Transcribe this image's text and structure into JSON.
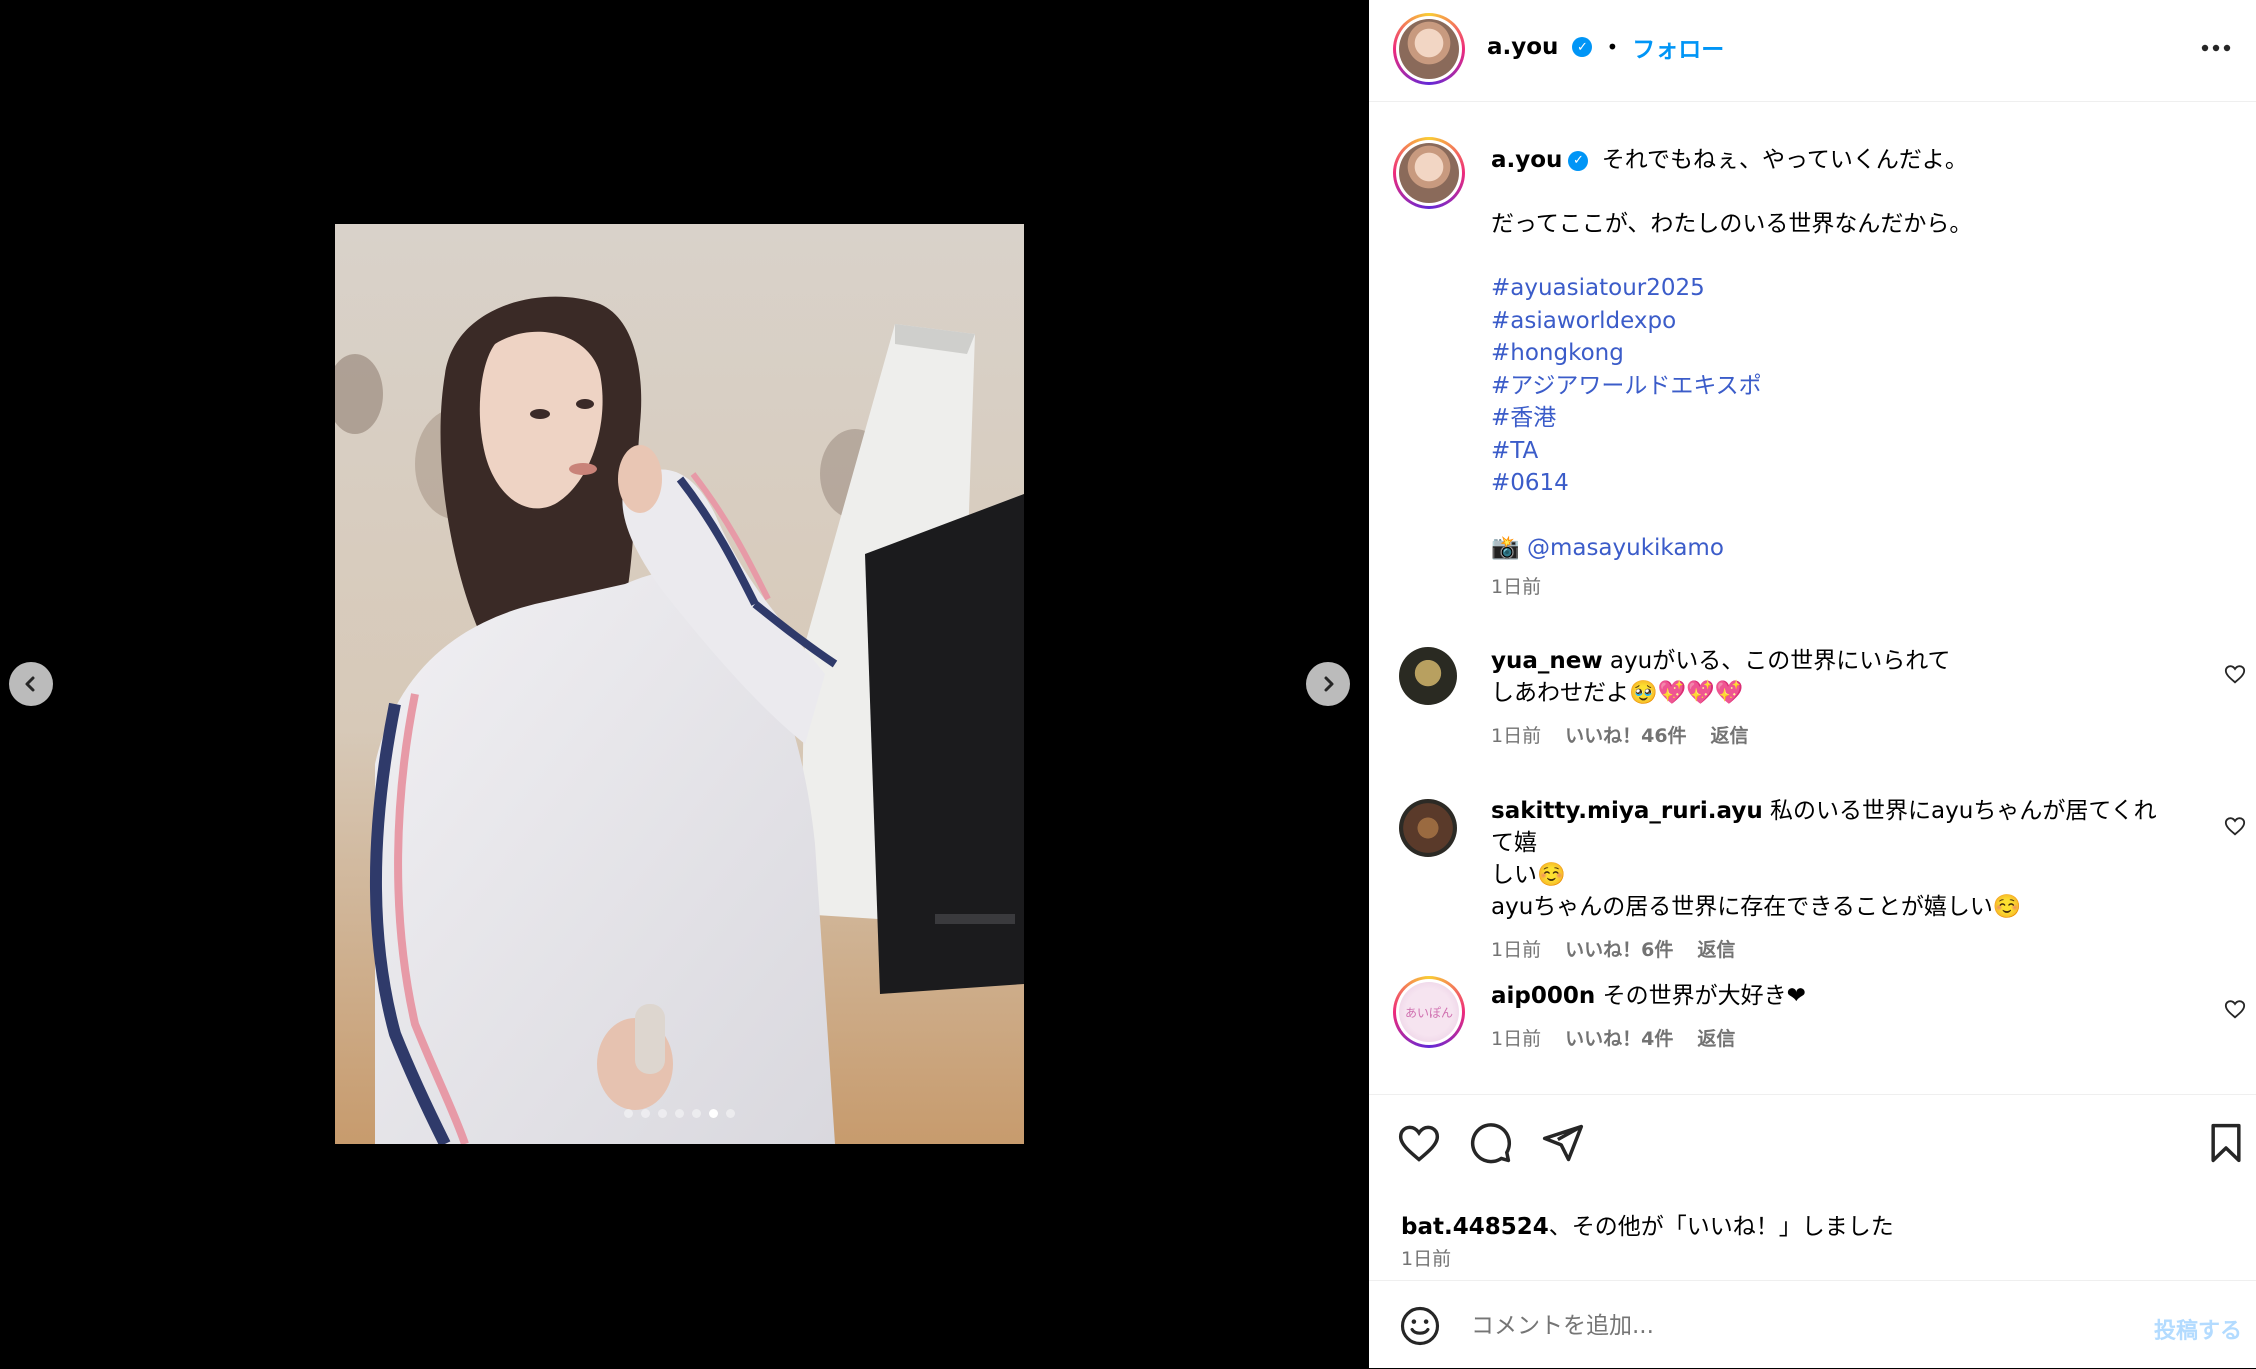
{
  "post": {
    "username": "a.you",
    "separator": "•",
    "follow_label": "フォロー",
    "more_label": "..."
  },
  "caption": {
    "username": "a.you",
    "line1": "それでもねぇ、やっていくんだよ。",
    "line2": "だってここが、わたしのいる世界なんだから。",
    "hashtags": [
      "#ayuasiatour2025",
      "#asiaworldexpo",
      "#hongkong",
      "#アジアワールドエキスポ",
      "#香港",
      "#TA",
      "#0614"
    ],
    "camera_emoji": "📸",
    "credit": "@masayukikamo",
    "time": "1日前"
  },
  "comments": [
    {
      "username": "yua_new",
      "text_line1": "ayuがいる、この世界にいられて",
      "text_line2": "しあわせだよ🥹💖💖💖",
      "time": "1日前",
      "likes": "いいね！46件",
      "reply": "返信"
    },
    {
      "username": "sakitty.miya_ruri.ayu",
      "text_line1": "私のいる世界にayuちゃんが居てくれて嬉",
      "text_line2": "しい☺️",
      "text_line3": "ayuちゃんの居る世界に存在できることが嬉しい☺️",
      "time": "1日前",
      "likes": "いいね！6件",
      "reply": "返信"
    },
    {
      "username": "aip000n",
      "avatar_text": "あいぽん",
      "text_line1": "その世界が大好き❤",
      "time": "1日前",
      "likes": "いいね！4件",
      "reply": "返信"
    }
  ],
  "likes_summary": {
    "user": "bat.448524",
    "rest": "、その他が「いいね！」しました",
    "time": "1日前"
  },
  "comment_input": {
    "placeholder": "コメントを追加...",
    "post_label": "投稿する"
  },
  "carousel": {
    "dot_count": 7,
    "active_index": 5
  },
  "colors": {
    "link_blue": "#0095f6",
    "hashtag_blue": "#3b5cc9",
    "muted_gray": "#737373"
  }
}
